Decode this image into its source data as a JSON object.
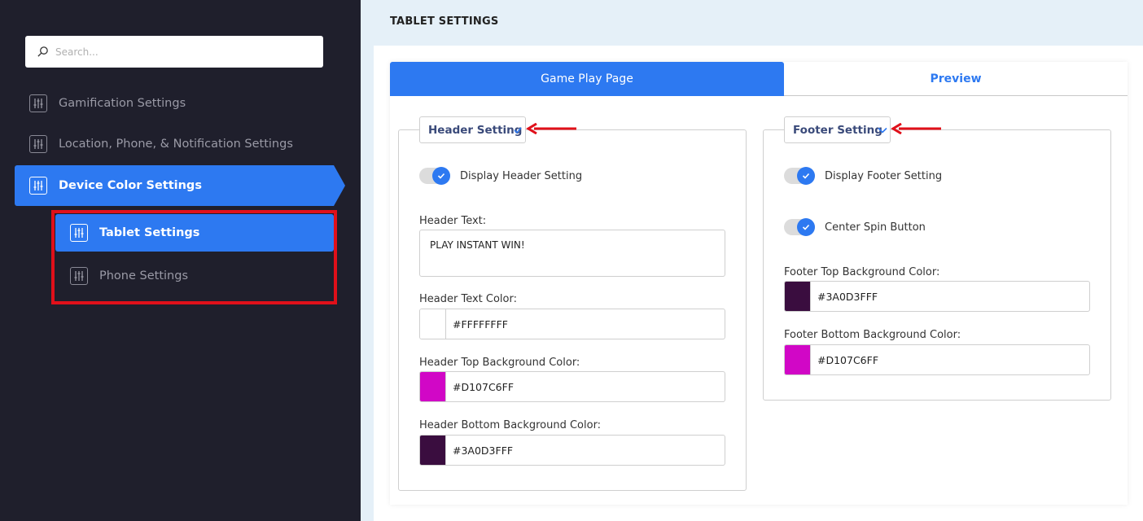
{
  "search": {
    "placeholder": "Search..."
  },
  "sidebar": {
    "items": [
      {
        "label": "Gamification Settings"
      },
      {
        "label": "Location, Phone, & Notification Settings"
      },
      {
        "label": "Device Color Settings"
      }
    ],
    "subitems": [
      {
        "label": "Tablet Settings"
      },
      {
        "label": "Phone Settings"
      }
    ]
  },
  "main": {
    "title": "TABLET SETTINGS",
    "tabs": [
      {
        "label": "Game Play Page"
      },
      {
        "label": "Preview"
      }
    ]
  },
  "header_section": {
    "legend": "Header Setting",
    "display_toggle_label": "Display Header Setting",
    "text_label": "Header Text:",
    "text_value": "PLAY INSTANT WIN!",
    "text_color_label": "Header Text Color:",
    "text_color": "#FFFFFFFF",
    "top_bg_label": "Header Top Background Color:",
    "top_bg": "#D107C6FF",
    "bottom_bg_label": "Header Bottom Background Color:",
    "bottom_bg": "#3A0D3FFF"
  },
  "footer_section": {
    "legend": "Footer Setting",
    "display_toggle_label": "Display Footer Setting",
    "center_spin_label": "Center Spin Button",
    "top_bg_label": "Footer Top Background Color:",
    "top_bg": "#3A0D3FFF",
    "bottom_bg_label": "Footer Bottom Background Color:",
    "bottom_bg": "#D107C6FF"
  },
  "colors": {
    "accent": "#2d79f1",
    "sidebar_bg": "#1f1f2c",
    "highlight_red": "#e0101a",
    "swatch_white": "#ffffff",
    "swatch_magenta": "#d107c6",
    "swatch_plum": "#3a0d3f"
  }
}
